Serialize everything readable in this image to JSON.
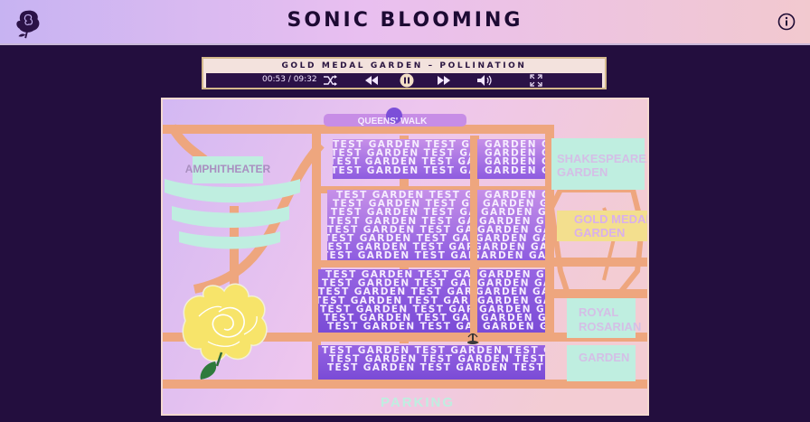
{
  "header": {
    "title": "SONIC BLOOMING",
    "logo_icon": "rose-icon",
    "info_icon": "info-icon"
  },
  "player": {
    "track_title": "GOLD MEDAL GARDEN – POLLINATION",
    "time": "00:53 / 09:32",
    "progress": 0.093,
    "controls": [
      "shuffle-icon",
      "rewind-icon",
      "pause-icon",
      "fast-forward-icon",
      "volume-icon",
      "fullscreen-icon"
    ]
  },
  "map": {
    "labels": {
      "queens_walk": "QUEENS' WALK",
      "amphitheater": "AMPHITHEATER",
      "shakespearean_1": "SHAKESPEAREAN",
      "shakespearean_2": "GARDEN",
      "gold_medal_1": "GOLD MEDAL",
      "gold_medal_2": "GARDEN",
      "royal_1": "ROYAL",
      "royal_2": "ROSARIAN",
      "garden": "GARDEN",
      "parking": "PARKING"
    },
    "test_garden_text": "TEST GARDEN",
    "garden_text": "GARDEN",
    "colors": {
      "paths": "#eea67e",
      "beds_light": "#c78de6",
      "beds_dark": "#7c4fd8",
      "labels_mint": "#bfeee0",
      "gold": "#f3df8e",
      "rose": "#f7e46a"
    }
  }
}
